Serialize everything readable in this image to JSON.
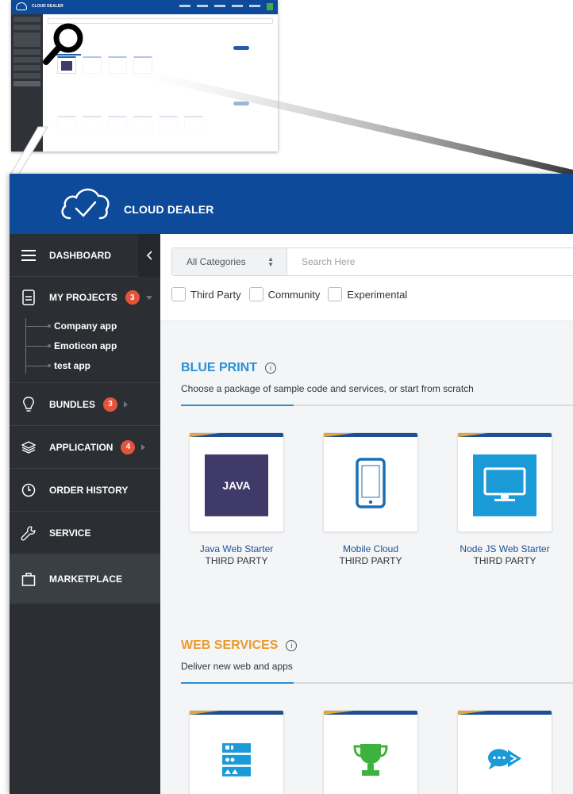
{
  "app": {
    "brand": "CLOUD DEALER"
  },
  "sidebar": {
    "items": [
      {
        "id": "dashboard",
        "label": "DASHBOARD",
        "icon": "menu-icon"
      },
      {
        "id": "my-projects",
        "label": "MY PROJECTS",
        "badge": "3",
        "icon": "document-icon",
        "children": [
          "Company app",
          "Emoticon app",
          "test app"
        ]
      },
      {
        "id": "bundles",
        "label": "BUNDLES",
        "badge": "3",
        "icon": "lightbulb-icon"
      },
      {
        "id": "application",
        "label": "APPLICATION",
        "badge": "4",
        "icon": "layers-icon"
      },
      {
        "id": "order-history",
        "label": "ORDER HISTORY",
        "icon": "clock-icon"
      },
      {
        "id": "service",
        "label": "SERVICE",
        "icon": "wrench-icon"
      },
      {
        "id": "marketplace",
        "label": "MARKETPLACE",
        "icon": "bag-icon",
        "active": true
      }
    ]
  },
  "filters": {
    "category_selected": "All Categories",
    "search_placeholder": "Search Here",
    "checkboxes": [
      "Third Party",
      "Community",
      "Experimental"
    ]
  },
  "sections": [
    {
      "title": "BLUE PRINT",
      "subtitle": "Choose a package of sample code and services, or start from scratch",
      "title_color": "#2b8fd6",
      "cards": [
        {
          "name": "Java Web Starter",
          "tag": "THIRD PARTY",
          "art_text": "JAVA",
          "icon": "java-tile"
        },
        {
          "name": "Mobile Cloud",
          "tag": "THIRD PARTY",
          "icon": "smartphone-icon"
        },
        {
          "name": "Node JS Web Starter",
          "tag": "THIRD PARTY",
          "icon": "monitor-icon"
        }
      ]
    },
    {
      "title": "WEB SERVICES",
      "subtitle": "Deliver new web and apps",
      "title_color": "#e89b2f",
      "cards": [
        {
          "icon": "server-icon"
        },
        {
          "icon": "trophy-icon"
        },
        {
          "icon": "chat-forward-icon"
        }
      ]
    }
  ],
  "colors": {
    "header": "#0d4a9a",
    "sidebar": "#2b2f33",
    "badge": "#e5533d",
    "card_bar": "#1d4f94",
    "card_corner": "#e6a53a",
    "java_tile": "#403a68",
    "monitor_tile": "#1a9ad6",
    "trophy": "#3db23d",
    "server": "#1a9ad6",
    "chat": "#1a9ad6"
  }
}
